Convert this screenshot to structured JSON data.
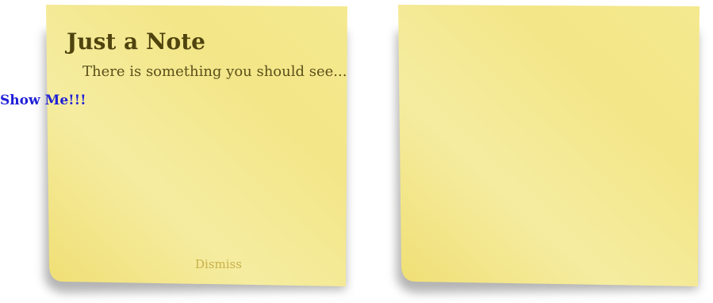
{
  "note": {
    "title": "Just a Note",
    "message": "There is something you should see...",
    "show_link": "Show Me!!!",
    "dismiss": "Dismiss"
  },
  "colors": {
    "note_fill_light": "#f5ec9f",
    "note_fill_dark": "#f1e27a",
    "title": "#4f430e",
    "link": "#1f1fd8",
    "dismiss": "#c9b04a"
  }
}
